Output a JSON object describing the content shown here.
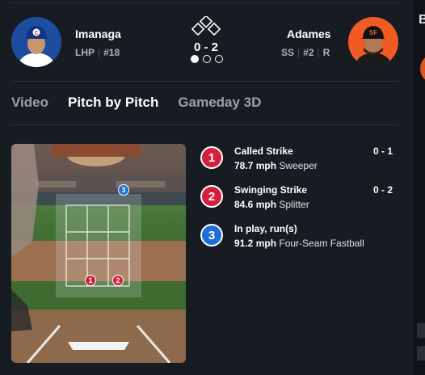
{
  "matchup": {
    "pitcher": {
      "name": "Imanaga",
      "position": "LHP",
      "number": "#18",
      "team_color": "#1d4d9e"
    },
    "batter": {
      "name": "Adames",
      "position": "SS",
      "number": "#2",
      "bats": "R",
      "team_color": "#f15a22"
    },
    "count": "0 - 2",
    "outs": {
      "filled": 1,
      "total": 3
    },
    "bases_icon": "bases-diamond-icon"
  },
  "tabs": [
    {
      "label": "Video",
      "active": false
    },
    {
      "label": "Pitch by Pitch",
      "active": true
    },
    {
      "label": "Gameday 3D",
      "active": false
    }
  ],
  "pitches": [
    {
      "num": "1",
      "result": "Called Strike",
      "speed": "78.7 mph",
      "type": "Sweeper",
      "count": "0 - 1",
      "color": "#d31f3d"
    },
    {
      "num": "2",
      "result": "Swinging Strike",
      "speed": "84.6 mph",
      "type": "Splitter",
      "count": "0 - 2",
      "color": "#d31f3d"
    },
    {
      "num": "3",
      "result": "In play, run(s)",
      "speed": "91.2 mph",
      "type": "Four-Seam Fastball",
      "count": "",
      "color": "#1f6ed4"
    }
  ],
  "field": {
    "pitch_markers": [
      {
        "num": "1",
        "color": "#d31f3d"
      },
      {
        "num": "2",
        "color": "#d31f3d"
      },
      {
        "num": "3",
        "color": "#1f6ed4"
      }
    ]
  },
  "peek": {
    "letter": "B"
  }
}
